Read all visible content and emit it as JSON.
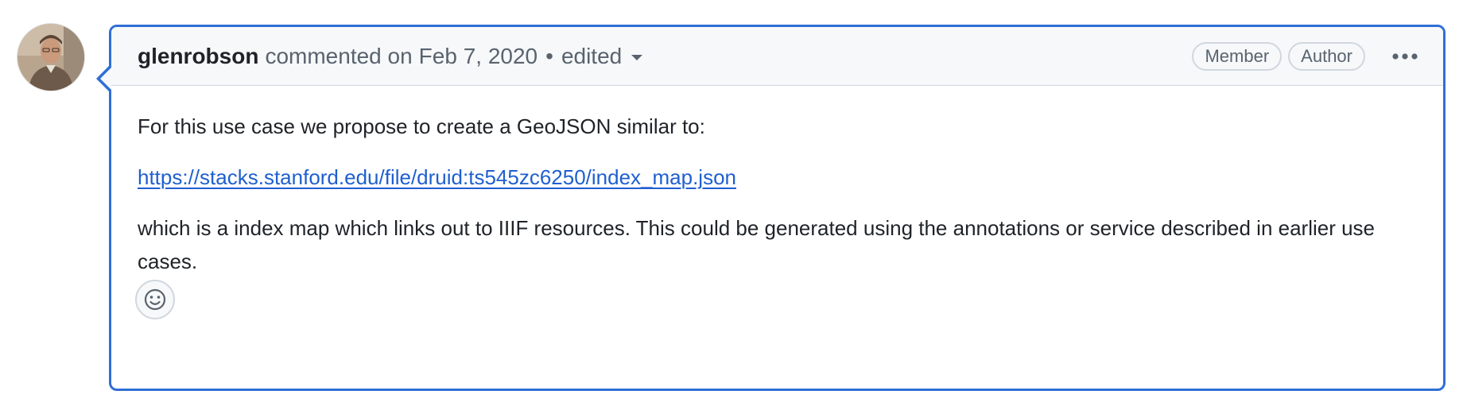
{
  "comment": {
    "author": "glenrobson",
    "action_text": "commented on",
    "date": "Feb 7, 2020",
    "separator": "•",
    "edited_label": "edited",
    "badges": [
      "Member",
      "Author"
    ],
    "body": {
      "paragraph_1": "For this use case we propose to create a GeoJSON similar to:",
      "link_text": "https://stacks.stanford.edu/file/druid:ts545zc6250/index_map.json",
      "paragraph_3": "which is a index map which links out to IIIF resources. This could be generated using the annotations or service described in earlier use cases."
    }
  },
  "icons": {
    "avatar": "user-avatar",
    "caret": "triangle-down-icon",
    "more": "kebab-horizontal-icon",
    "reaction": "smiley-icon"
  },
  "colors": {
    "accent_border": "#2f6fd6",
    "link": "#1f5fd0",
    "header_bg": "#f6f8fa",
    "muted_text": "#59636e"
  }
}
